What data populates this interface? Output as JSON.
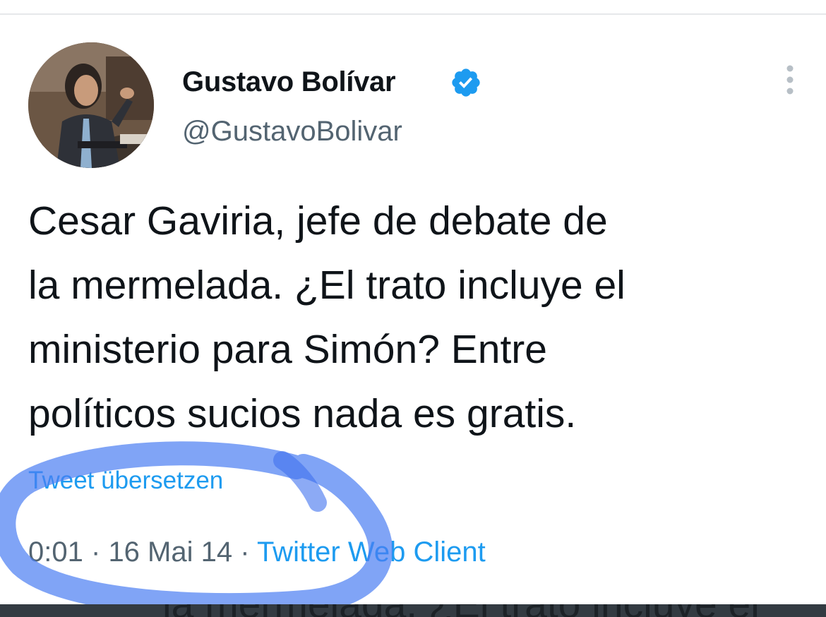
{
  "tweet": {
    "author": {
      "display_name": "Gustavo Bolívar",
      "handle": "@GustavoBolivar",
      "verified": true
    },
    "text": "Cesar Gaviria, jefe de debate de\nla mermelada. ¿El trato incluye el\nministerio para Simón? Entre\npolíticos sucios nada es gratis.",
    "translate_label": "Tweet übersetzen",
    "time": "0:01",
    "separator": "·",
    "date": "16 Mai 14",
    "source": "Twitter Web Client"
  },
  "background_partial_text": "la mermelada. ¿El trato incluye el",
  "icons": {
    "verified": "verified-badge-icon",
    "more": "more-vertical-icon"
  },
  "colors": {
    "link_blue": "#1d9bf0",
    "muted_text": "#536471",
    "verified_blue": "#1d9bf0",
    "highlight": "#4a7df2"
  }
}
